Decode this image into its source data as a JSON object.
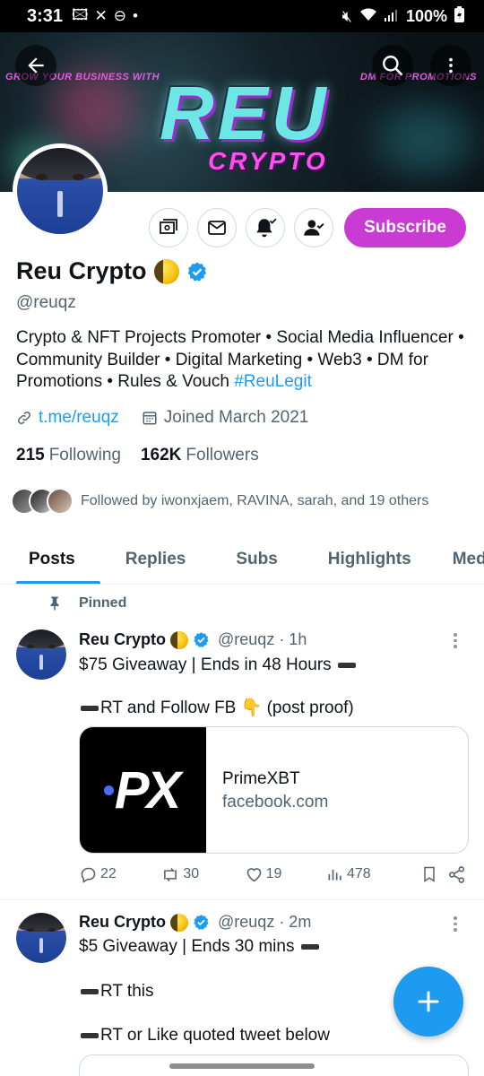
{
  "status_bar": {
    "time": "3:31",
    "battery": "100%"
  },
  "banner": {
    "tagline_left": "GROW YOUR BUSINESS WITH",
    "tagline_right": "DM FOR PROMOTIONS",
    "logo_main": "REU",
    "logo_sub": "CRYPTO"
  },
  "profile": {
    "name": "Reu Crypto",
    "handle": "@reuqz",
    "bio_text": "Crypto & NFT Projects Promoter • Social Media Influencer • Community Builder • Digital Marketing • Web3 • DM for Promotions • Rules & Vouch ",
    "bio_hashtag": "#ReuLegit",
    "link": "t.me/reuqz",
    "joined": "Joined March 2021",
    "following_count": "215",
    "following_label": "Following",
    "followers_count": "162K",
    "followers_label": "Followers",
    "followed_by": "Followed by iwonxjaem, RAVINA, sarah, and 19 others",
    "subscribe_label": "Subscribe"
  },
  "tabs": [
    "Posts",
    "Replies",
    "Subs",
    "Highlights",
    "Media"
  ],
  "posts": [
    {
      "pinned_label": "Pinned",
      "name": "Reu Crypto",
      "handle_time": "@reuqz · 1h",
      "line1": "$75 Giveaway | Ends in 48 Hours",
      "line2": "RT and Follow FB",
      "line2_suffix": "(post proof)",
      "card": {
        "brand": "PX",
        "title": "PrimeXBT",
        "domain": "facebook.com"
      },
      "replies": "22",
      "reposts": "30",
      "likes": "19",
      "views": "478"
    },
    {
      "name": "Reu Crypto",
      "handle_time": "@reuqz · 2m",
      "line1": "$5 Giveaway | Ends 30 mins",
      "line2": "RT this",
      "line3": "RT or Like quoted tweet below"
    }
  ],
  "colors": {
    "accent": "#1d9bf0",
    "subscribe": "#c93bd3",
    "text": "#0f1419",
    "muted": "#536471"
  }
}
